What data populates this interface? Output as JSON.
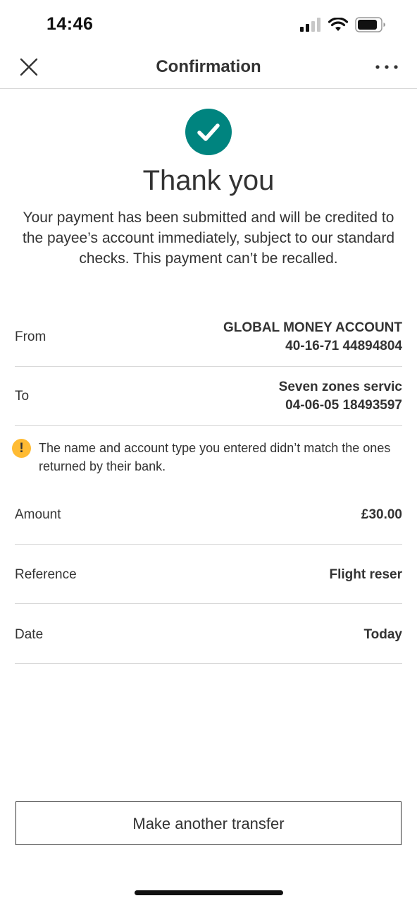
{
  "status_bar": {
    "time": "14:46",
    "icons": [
      "signal-icon",
      "wifi-icon",
      "battery-icon"
    ]
  },
  "nav": {
    "title": "Confirmation",
    "left_icon": "close-icon",
    "right_icon": "more-icon"
  },
  "confirmation": {
    "icon": "check-circle-icon",
    "heading": "Thank you",
    "message": "Your payment has been submitted and will be credited to the payee’s account immediately, subject to our standard checks. This payment can’t be recalled."
  },
  "details": {
    "from": {
      "label": "From",
      "name": "GLOBAL MONEY ACCOUNT",
      "account": "40-16-71 44894804"
    },
    "to": {
      "label": "To",
      "name": "Seven zones servic",
      "account": "04-06-05 18493597"
    },
    "warning": {
      "icon": "warning-icon",
      "text": "The name and account type you entered didn’t match the ones returned by their bank."
    },
    "amount": {
      "label": "Amount",
      "value": "£30.00"
    },
    "reference": {
      "label": "Reference",
      "value": "Flight reser"
    },
    "date": {
      "label": "Date",
      "value": "Today"
    }
  },
  "actions": {
    "make_another_transfer": "Make another transfer"
  },
  "colors": {
    "accent": "#00847f",
    "warning": "#ffbb33",
    "text": "#333333",
    "divider": "#d9d9d9"
  }
}
